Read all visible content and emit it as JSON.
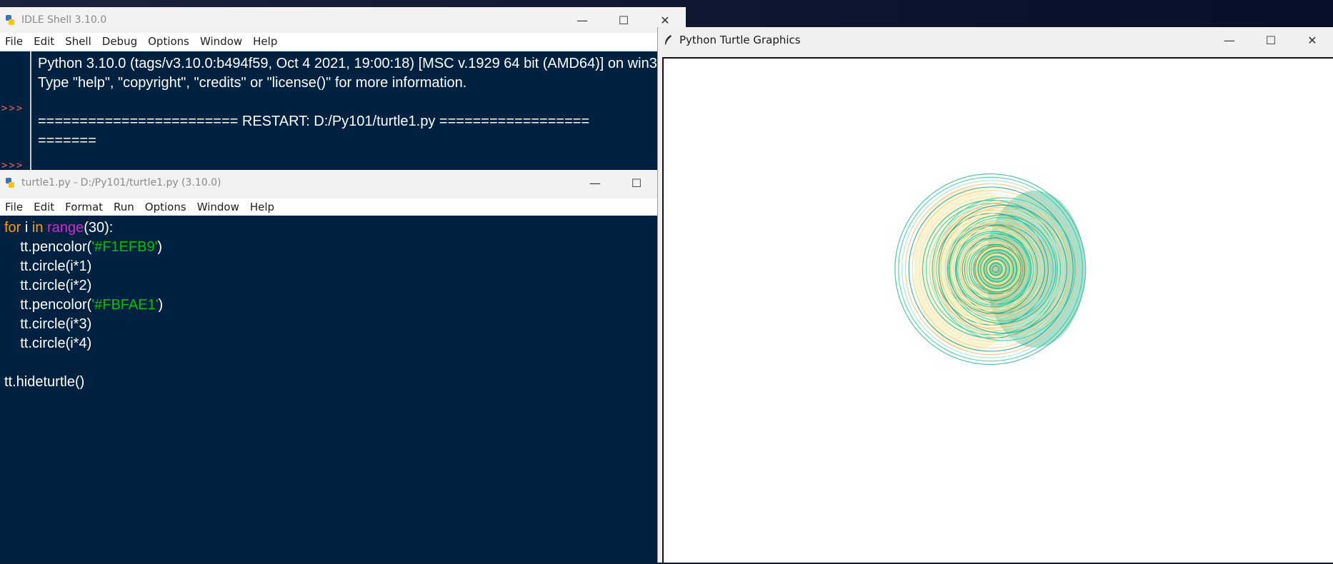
{
  "shell": {
    "title": "IDLE Shell 3.10.0",
    "menu": [
      "File",
      "Edit",
      "Shell",
      "Debug",
      "Options",
      "Window",
      "Help"
    ],
    "lines": [
      "Python 3.10.0 (tags/v3.10.0:b494f59, Oct  4 2021, 19:00:18) [MSC v.1929 64 bit (AMD64)] on win3",
      "Type \"help\", \"copyright\", \"credits\" or \"license()\" for more information.",
      "",
      "======================== RESTART: D:/Py101/turtle1.py ==================",
      "======="
    ],
    "prompt": ">>>"
  },
  "editor": {
    "title": "turtle1.py - D:/Py101/turtle1.py (3.10.0)",
    "menu": [
      "File",
      "Edit",
      "Format",
      "Run",
      "Options",
      "Window",
      "Help"
    ],
    "code": {
      "l1_kw1": "for",
      "l1_var": " i ",
      "l1_kw2": "in",
      "l1_sp": " ",
      "l1_bi": "range",
      "l1_rest": "(30):",
      "l2_pre": "    tt.pencolor(",
      "l2_str": "'#F1EFB9'",
      "l2_post": ")",
      "l3": "    tt.circle(i*1)",
      "l4": "    tt.circle(i*2)",
      "l5_pre": "    tt.pencolor(",
      "l5_str": "'#FBFAE1'",
      "l5_post": ")",
      "l6": "    tt.circle(i*3)",
      "l7": "    tt.circle(i*4)",
      "l9": "tt.hideturtle()"
    }
  },
  "turtle": {
    "title": "Python Turtle Graphics"
  },
  "colors": {
    "editor_bg": "#002240",
    "keyword": "#ff9a1f",
    "builtin": "#d22ad2",
    "string": "#00c000",
    "prompt": "#ff6060"
  }
}
